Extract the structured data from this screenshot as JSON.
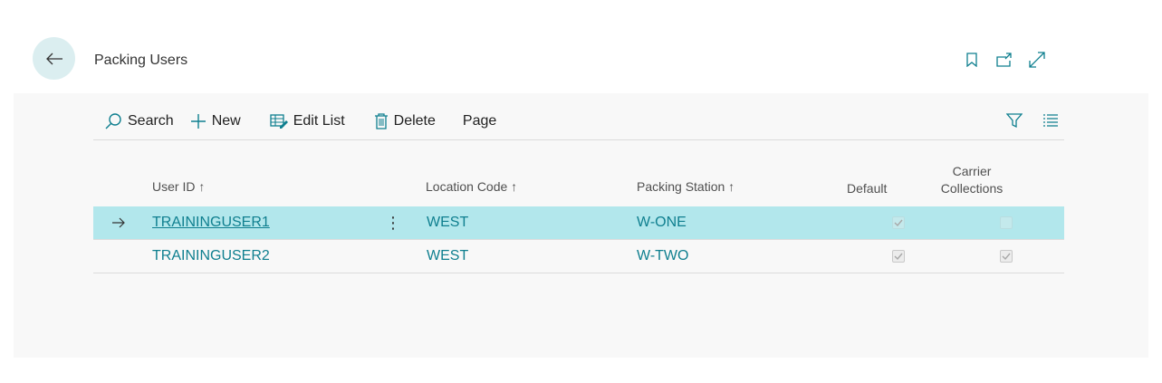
{
  "page": {
    "title": "Packing Users"
  },
  "toolbar": {
    "search_label": "Search",
    "new_label": "New",
    "edit_list_label": "Edit List",
    "delete_label": "Delete",
    "page_label": "Page"
  },
  "columns": {
    "user_id": "User ID ↑",
    "location_code": "Location Code ↑",
    "packing_station": "Packing Station ↑",
    "default": "Default",
    "carrier_collections": "Carrier Collections"
  },
  "rows": [
    {
      "user_id": "TRAININGUSER1",
      "location_code": "WEST",
      "packing_station": "W-ONE",
      "default": true,
      "carrier_collections": false
    },
    {
      "user_id": "TRAININGUSER2",
      "location_code": "WEST",
      "packing_station": "W-TWO",
      "default": true,
      "carrier_collections": true
    }
  ],
  "colors": {
    "accent": "#0f7f8f",
    "selected_row": "#b2e7ec",
    "back_button": "#dbeef0"
  }
}
